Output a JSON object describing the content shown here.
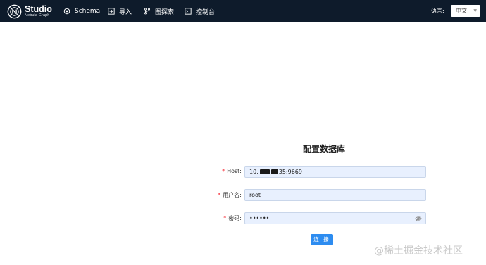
{
  "brand": {
    "title": "Studio",
    "subtitle": "Nebula Graph"
  },
  "nav": {
    "items": [
      {
        "label": "Schema",
        "icon": "schema-icon"
      },
      {
        "label": "导入",
        "icon": "import-icon"
      },
      {
        "label": "图探索",
        "icon": "explore-icon"
      },
      {
        "label": "控制台",
        "icon": "console-icon"
      }
    ]
  },
  "lang": {
    "label": "语言:",
    "selected": "中文"
  },
  "form": {
    "title": "配置数据库",
    "host": {
      "label": "Host",
      "value_start": "10.",
      "value_end": "35:9669"
    },
    "username": {
      "label": "用户名",
      "value": "root"
    },
    "password": {
      "label": "密码",
      "value": "••••••"
    },
    "submit_label": "连 接"
  },
  "watermark": "@稀土掘金技术社区",
  "colors": {
    "navbar": "#0e1b2b",
    "accent": "#2d8cf0",
    "field_bg": "#e8f0fe",
    "required": "#f5222d"
  }
}
